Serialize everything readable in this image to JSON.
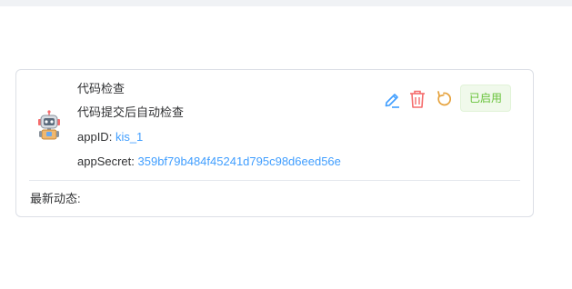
{
  "app_card": {
    "name": "代码检查",
    "description": "代码提交后自动检查",
    "appid_label": "appID:",
    "appid_value": "kis_1",
    "appsecret_label": "appSecret:",
    "appsecret_value": "359bf79b484f45241d795c98d6eed56e",
    "status": "已启用",
    "latest_label": "最新动态:"
  },
  "icons": {
    "avatar": "robot-icon",
    "edit": "pencil-icon",
    "delete": "trash-icon",
    "reset": "refresh-icon"
  },
  "colors": {
    "link": "#409eff",
    "edit_icon": "#409eff",
    "delete_icon": "#f56c6c",
    "reset_icon": "#e6a23c",
    "status_text": "#67c23a",
    "status_bg": "#f0f9eb"
  }
}
